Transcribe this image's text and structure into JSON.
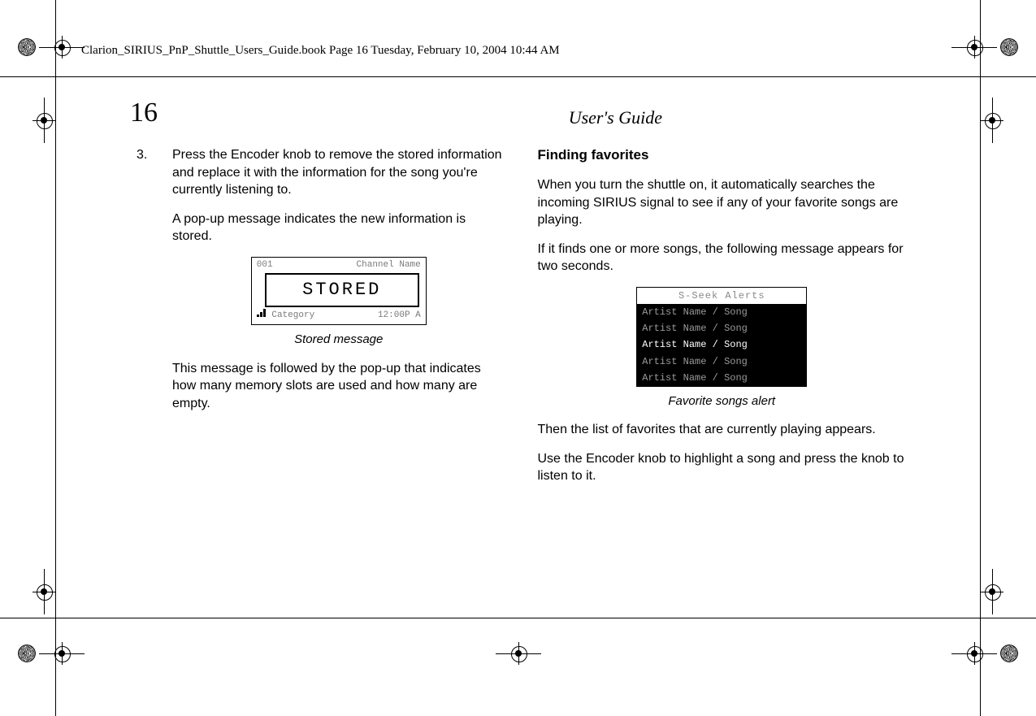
{
  "header": "Clarion_SIRIUS_PnP_Shuttle_Users_Guide.book  Page 16  Tuesday, February 10, 2004  10:44 AM",
  "page_number": "16",
  "page_title": "User's Guide",
  "left": {
    "step_num": "3.",
    "step_text": "Press the Encoder knob to remove the stored information and replace it with the information for the song you're currently listening to.",
    "para2": "A pop-up message indicates the new information is stored.",
    "lcd": {
      "channel_num": "001",
      "channel_label": "Channel Name",
      "popup": "STORED",
      "category": "Category",
      "time": "12:00P A"
    },
    "caption": "Stored message",
    "para3": "This message is followed by the pop-up that indicates how many memory slots are used and how many are empty."
  },
  "right": {
    "heading": "Finding favorites",
    "para1": "When you turn the shuttle on, it automatically searches the incoming SIRIUS signal to see if any of your favorite songs are playing.",
    "para2": "If it finds one or more songs, the following message appears for two seconds.",
    "lcd": {
      "title": "S-Seek Alerts",
      "rows": [
        "Artist Name / Song",
        "Artist Name / Song",
        "Artist Name / Song",
        "Artist Name / Song",
        "Artist Name / Song"
      ]
    },
    "caption": "Favorite songs alert",
    "para3": "Then the list of favorites that are currently playing appears.",
    "para4": "Use the Encoder knob to highlight a song and press the knob to listen to it."
  }
}
